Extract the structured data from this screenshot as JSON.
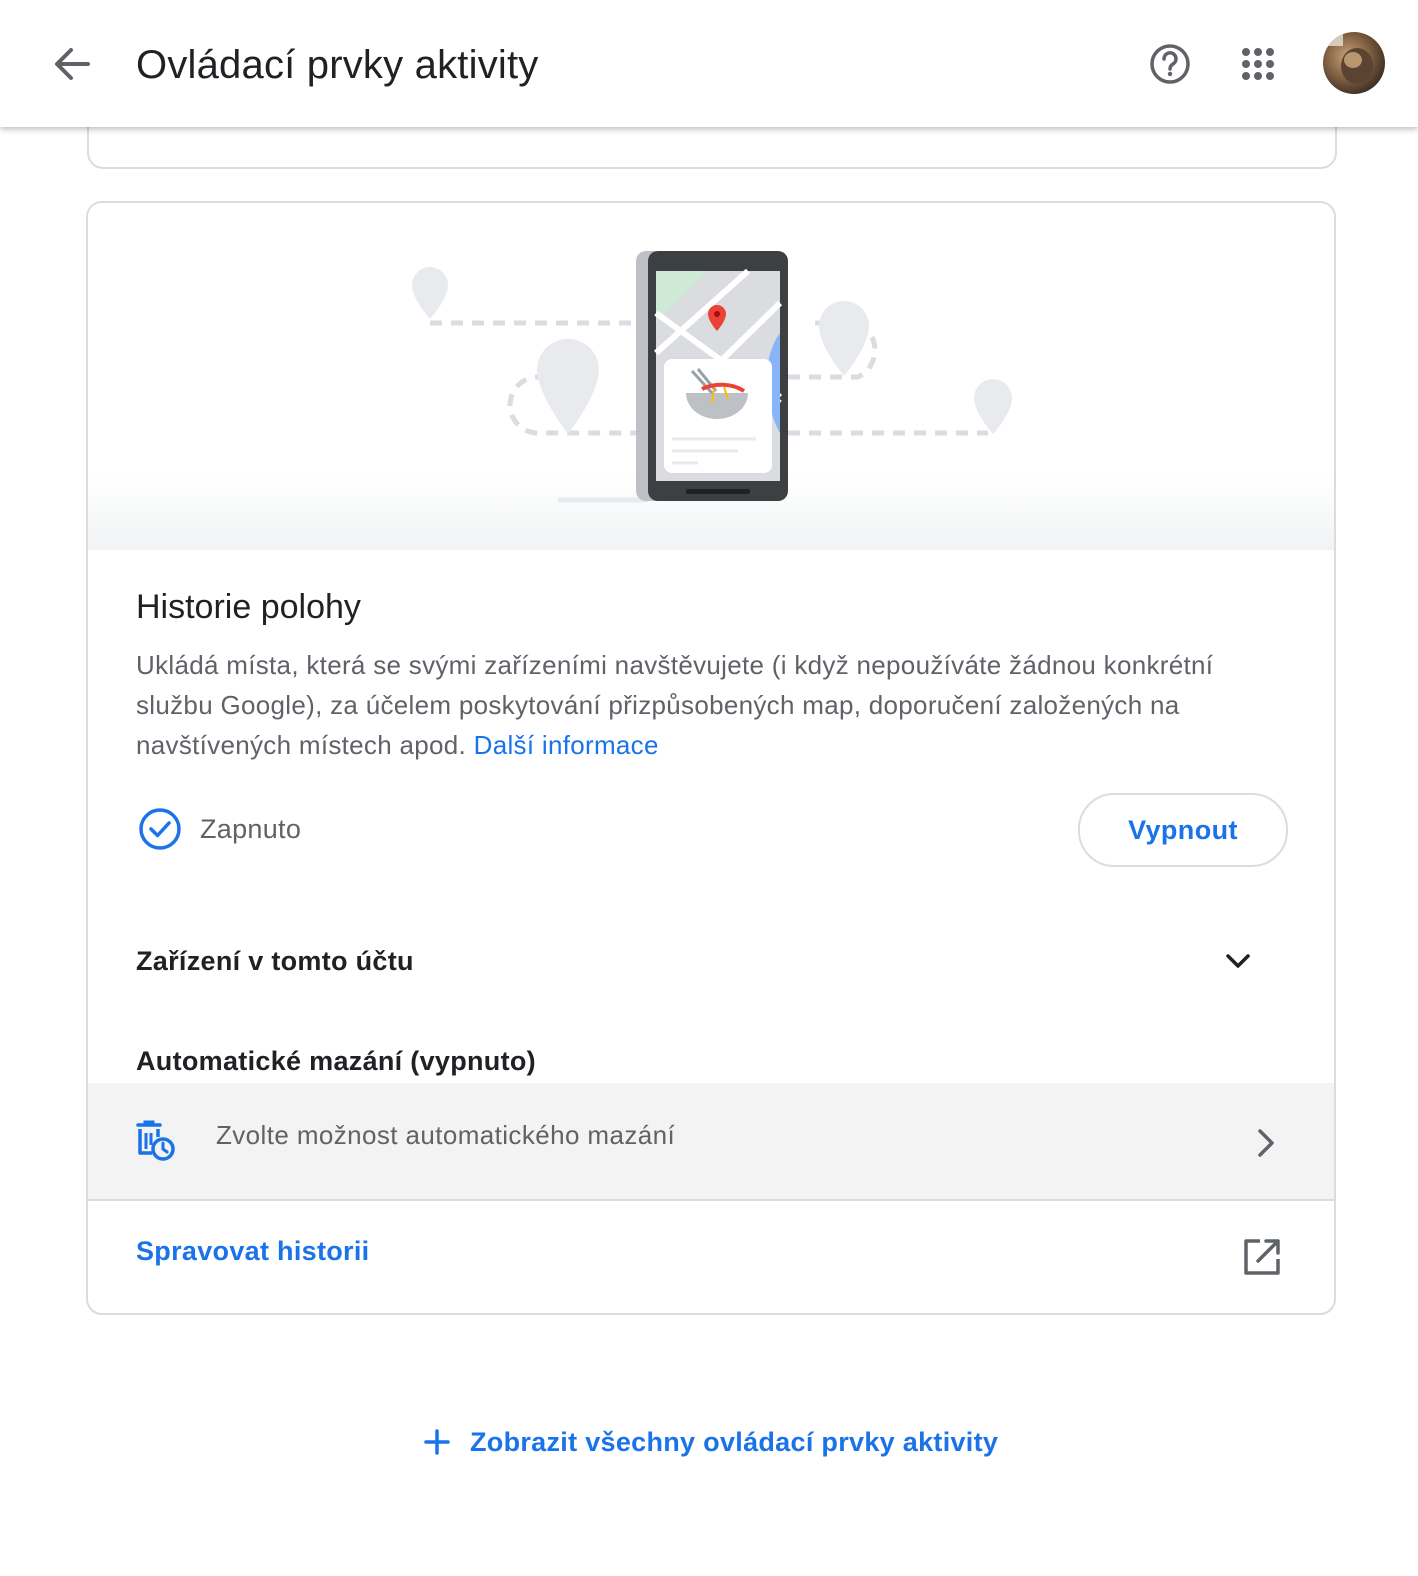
{
  "header": {
    "title": "Ovládací prvky aktivity",
    "back_icon": "arrow-back-icon",
    "help_icon": "help-circle-icon",
    "apps_icon": "apps-grid-icon",
    "avatar": "user-avatar"
  },
  "location_history": {
    "title": "Historie polohy",
    "description": "Ukládá místa, která se svými zařízeními navštěvujete (i když nepoužíváte žádnou konkrétní službu Google), za účelem poskytování přizpůsobených map, doporučení založených na navštívených místech apod.",
    "learn_more": "Další informace",
    "status": "Zapnuto",
    "turn_off_button": "Vypnout",
    "devices_label": "Zařízení v tomto účtu",
    "auto_delete_label": "Automatické mazání (vypnuto)",
    "auto_delete_option": "Zvolte možnost automatického mazání",
    "manage_history": "Spravovat historii"
  },
  "show_all": "Zobrazit všechny ovládací prvky aktivity",
  "colors": {
    "accent": "#1a73e8",
    "text_primary": "#202124",
    "text_secondary": "#5f6368",
    "border": "#dadce0",
    "map_pin": "#ea4335"
  }
}
